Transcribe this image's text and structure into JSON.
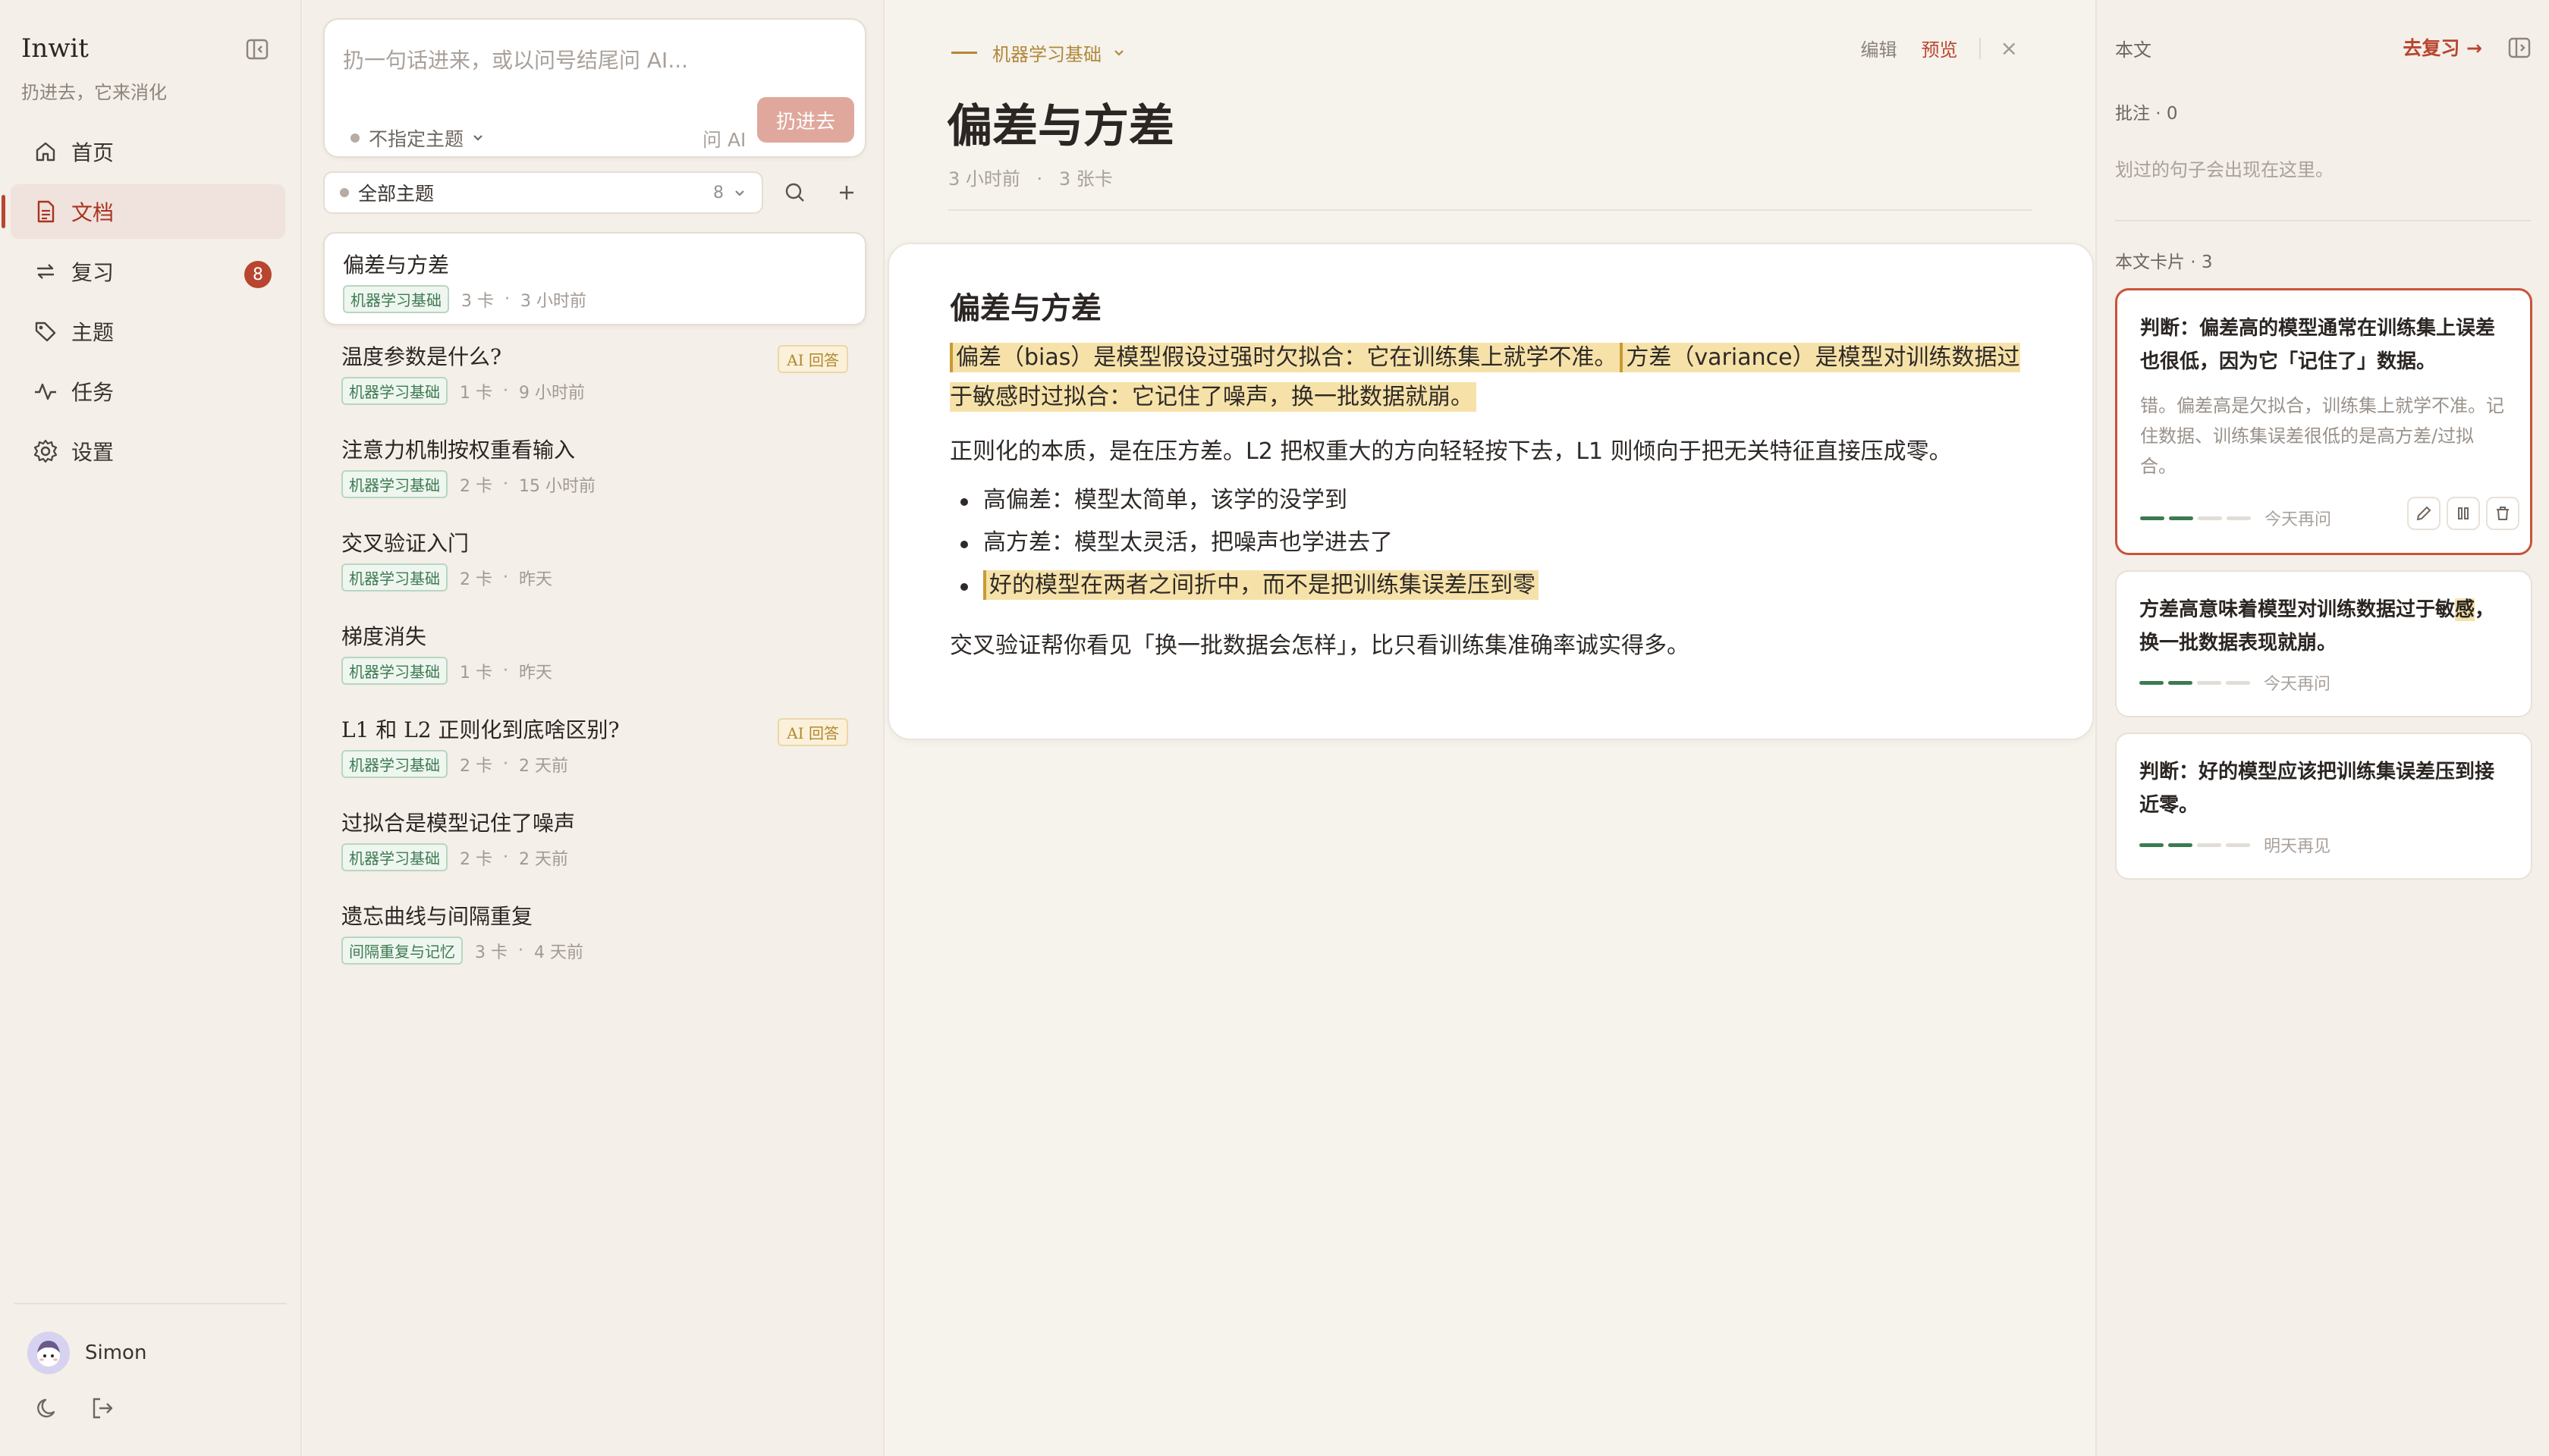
{
  "app": {
    "name": "Inwit",
    "tagline": "扔进去，它来消化"
  },
  "nav": [
    {
      "label": "首页",
      "icon": "home-icon"
    },
    {
      "label": "文档",
      "icon": "document-icon",
      "active": true
    },
    {
      "label": "复习",
      "icon": "review-icon",
      "badge": "8"
    },
    {
      "label": "主题",
      "icon": "tag-icon"
    },
    {
      "label": "任务",
      "icon": "activity-icon"
    },
    {
      "label": "设置",
      "icon": "gear-icon"
    }
  ],
  "user": {
    "name": "Simon"
  },
  "composer": {
    "placeholder": "扔一句话进来，或以问号结尾问 AI...",
    "topic": "不指定主题",
    "ask": "问 AI",
    "send": "扔进去"
  },
  "filter": {
    "label": "全部主题",
    "count": "8"
  },
  "docs": [
    {
      "title": "偏差与方差",
      "tag": "机器学习基础",
      "cards": "3 卡",
      "time": "3 小时前",
      "selected": true
    },
    {
      "title": "温度参数是什么?",
      "tag": "机器学习基础",
      "cards": "1 卡",
      "time": "9 小时前",
      "ai": "AI 回答"
    },
    {
      "title": "注意力机制按权重看输入",
      "tag": "机器学习基础",
      "cards": "2 卡",
      "time": "15 小时前"
    },
    {
      "title": "交叉验证入门",
      "tag": "机器学习基础",
      "cards": "2 卡",
      "time": "昨天"
    },
    {
      "title": "梯度消失",
      "tag": "机器学习基础",
      "cards": "1 卡",
      "time": "昨天"
    },
    {
      "title": "L1 和 L2 正则化到底啥区别?",
      "tag": "机器学习基础",
      "cards": "2 卡",
      "time": "2 天前",
      "ai": "AI 回答"
    },
    {
      "title": "过拟合是模型记住了噪声",
      "tag": "机器学习基础",
      "cards": "2 卡",
      "time": "2 天前"
    },
    {
      "title": "遗忘曲线与间隔重复",
      "tag": "间隔重复与记忆",
      "cards": "3 卡",
      "time": "4 天前"
    }
  ],
  "main": {
    "breadcrumb": "机器学习基础",
    "edit": "编辑",
    "preview": "预览",
    "close": "×",
    "title": "偏差与方差",
    "meta_time": "3 小时前",
    "meta_dot": "·",
    "meta_cards": "3 张卡",
    "doc_heading": "偏差与方差",
    "para1_a": "偏差（bias）是模型假设过强时欠拟合：它在训练集上就学不准。",
    "para1_b": "方差（variance）是模型对训练数据过于敏感时过拟合：它记住了噪声，换一批数据就崩。",
    "para2": "正则化的本质，是在压方差。L2 把权重大的方向轻轻按下去，L1 则倾向于把无关特征直接压成零。",
    "bullets": [
      "高偏差：模型太简单，该学的没学到",
      "高方差：模型太灵活，把噪声也学进去了",
      "好的模型在两者之间折中，而不是把训练集误差压到零"
    ],
    "para3": "交叉验证帮你看见「换一批数据会怎样」，比只看训练集准确率诚实得多。"
  },
  "right": {
    "title": "本文",
    "review": "去复习 →",
    "notes_label": "批注 · 0",
    "notes_hint": "划过的句子会出现在这里。",
    "cards_label": "本文卡片 · 3",
    "cards": [
      {
        "q": "判断：偏差高的模型通常在训练集上误差也很低，因为它「记住了」数据。",
        "a": "错。偏差高是欠拟合，训练集上就学不准。记住数据、训练集误差很低的是高方差/过拟合。",
        "due": "今天再问",
        "level": 2
      },
      {
        "q_a": "方差高意味着模型对训练数据过于敏",
        "q_hl": "感",
        "q_b": "，换一批数据表现就崩",
        "q_hl2": "崩",
        "q_end": "。",
        "due": "今天再问",
        "level": 2
      },
      {
        "q": "判断：好的模型应该把训练集误差压到接近零。",
        "due": "明天再见",
        "level": 2
      }
    ]
  },
  "colors": {
    "accent": "#b8452f",
    "highlight": "#f6e2a9",
    "tag_green": "#3d7a52",
    "gold": "#b0893a"
  }
}
